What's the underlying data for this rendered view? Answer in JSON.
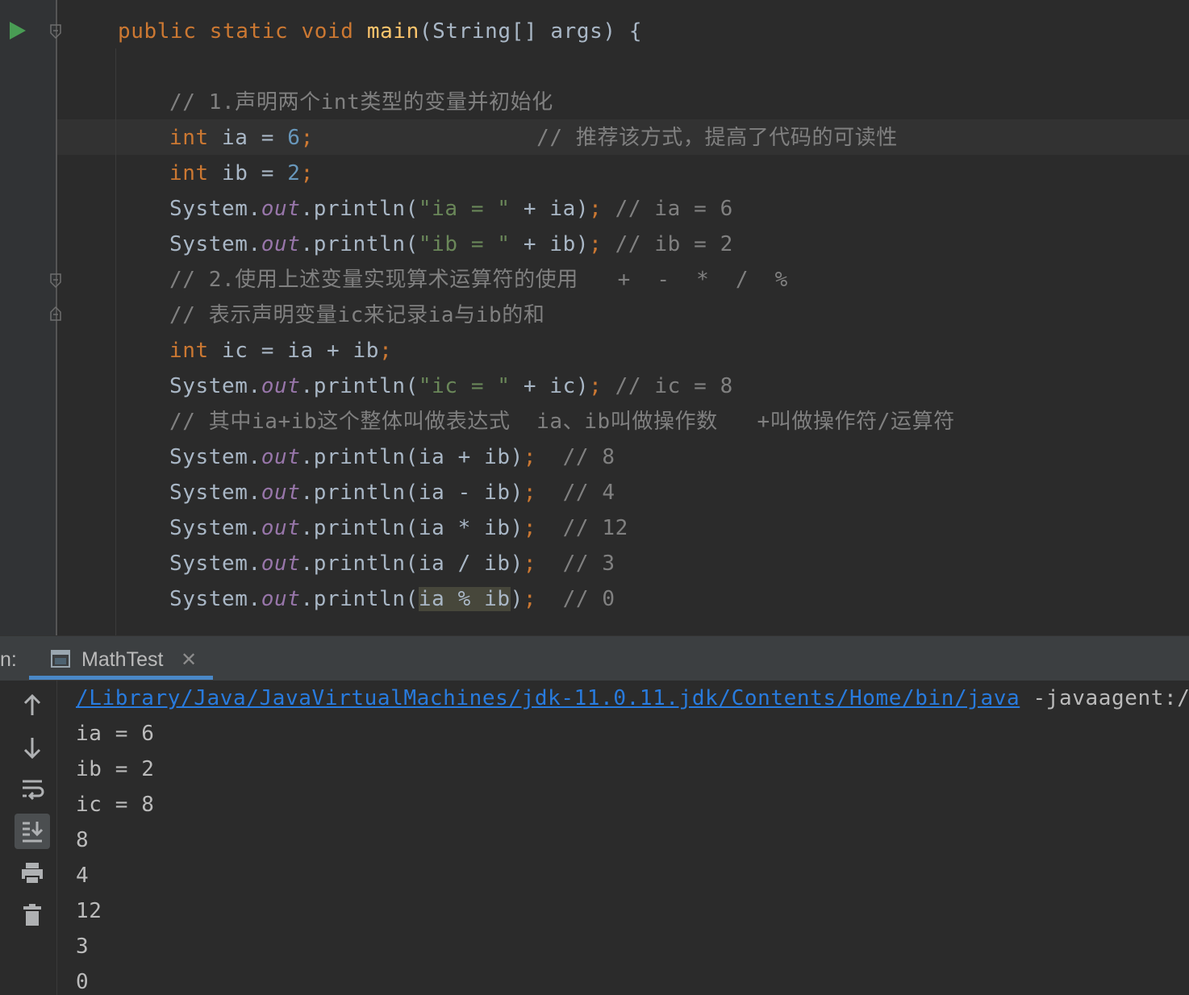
{
  "editor": {
    "lines": [
      [
        {
          "t": "public static void ",
          "c": "kw"
        },
        {
          "t": "main",
          "c": "fn"
        },
        {
          "t": "(String[] args) {",
          "c": ""
        }
      ],
      [],
      [
        {
          "t": "// 1.声明两个int类型的变量并初始化",
          "c": "cm"
        }
      ],
      [
        {
          "t": "int ",
          "c": "kw"
        },
        {
          "t": "ia = ",
          "c": ""
        },
        {
          "t": "6",
          "c": "num"
        },
        {
          "t": ";",
          "c": "kw"
        },
        {
          "t": "                 // 推荐该方式，提高了代码的可读性",
          "c": "cm"
        }
      ],
      [
        {
          "t": "int ",
          "c": "kw"
        },
        {
          "t": "ib = ",
          "c": ""
        },
        {
          "t": "2",
          "c": "num"
        },
        {
          "t": ";",
          "c": "kw"
        }
      ],
      [
        {
          "t": "System.",
          "c": ""
        },
        {
          "t": "out",
          "c": "fld"
        },
        {
          "t": ".println(",
          "c": ""
        },
        {
          "t": "\"ia = \"",
          "c": "str"
        },
        {
          "t": " + ia)",
          "c": ""
        },
        {
          "t": ";",
          "c": "kw"
        },
        {
          "t": " // ia = 6",
          "c": "cm"
        }
      ],
      [
        {
          "t": "System.",
          "c": ""
        },
        {
          "t": "out",
          "c": "fld"
        },
        {
          "t": ".println(",
          "c": ""
        },
        {
          "t": "\"ib = \"",
          "c": "str"
        },
        {
          "t": " + ib)",
          "c": ""
        },
        {
          "t": ";",
          "c": "kw"
        },
        {
          "t": " // ib = 2",
          "c": "cm"
        }
      ],
      [
        {
          "t": "// 2.使用上述变量实现算术运算符的使用   +  -  *  /  %",
          "c": "cm"
        }
      ],
      [
        {
          "t": "// 表示声明变量ic来记录ia与ib的和",
          "c": "cm"
        }
      ],
      [
        {
          "t": "int ",
          "c": "kw"
        },
        {
          "t": "ic = ia + ib",
          "c": ""
        },
        {
          "t": ";",
          "c": "kw"
        }
      ],
      [
        {
          "t": "System.",
          "c": ""
        },
        {
          "t": "out",
          "c": "fld"
        },
        {
          "t": ".println(",
          "c": ""
        },
        {
          "t": "\"ic = \"",
          "c": "str"
        },
        {
          "t": " + ic)",
          "c": ""
        },
        {
          "t": ";",
          "c": "kw"
        },
        {
          "t": " // ic = 8",
          "c": "cm"
        }
      ],
      [
        {
          "t": "// 其中ia+ib这个整体叫做表达式  ia、ib叫做操作数   +叫做操作符/运算符",
          "c": "cm"
        }
      ],
      [
        {
          "t": "System.",
          "c": ""
        },
        {
          "t": "out",
          "c": "fld"
        },
        {
          "t": ".println(ia + ib)",
          "c": ""
        },
        {
          "t": ";",
          "c": "kw"
        },
        {
          "t": "  // 8",
          "c": "cm"
        }
      ],
      [
        {
          "t": "System.",
          "c": ""
        },
        {
          "t": "out",
          "c": "fld"
        },
        {
          "t": ".println(ia - ib)",
          "c": ""
        },
        {
          "t": ";",
          "c": "kw"
        },
        {
          "t": "  // 4",
          "c": "cm"
        }
      ],
      [
        {
          "t": "System.",
          "c": ""
        },
        {
          "t": "out",
          "c": "fld"
        },
        {
          "t": ".println(ia * ib)",
          "c": ""
        },
        {
          "t": ";",
          "c": "kw"
        },
        {
          "t": "  // 12",
          "c": "cm"
        }
      ],
      [
        {
          "t": "System.",
          "c": ""
        },
        {
          "t": "out",
          "c": "fld"
        },
        {
          "t": ".println(ia / ib)",
          "c": ""
        },
        {
          "t": ";",
          "c": "kw"
        },
        {
          "t": "  // 3",
          "c": "cm"
        }
      ],
      [
        {
          "t": "System.",
          "c": ""
        },
        {
          "t": "out",
          "c": "fld"
        },
        {
          "t": ".println(",
          "c": ""
        },
        {
          "t": "ia % ib",
          "c": "hl"
        },
        {
          "t": ")",
          "c": ""
        },
        {
          "t": ";",
          "c": "kw"
        },
        {
          "t": "  // 0",
          "c": "cm"
        }
      ]
    ]
  },
  "run_panel": {
    "label": "n:",
    "tab": {
      "title": "MathTest",
      "close": "✕"
    },
    "console": {
      "java_path": "/Library/Java/JavaVirtualMachines/jdk-11.0.11.jdk/Contents/Home/bin/java",
      "java_args": " -javaagent:/Ap",
      "output": [
        "ia = 6",
        "ib = 2",
        "ic = 8",
        "8",
        "4",
        "12",
        "3",
        "0"
      ]
    },
    "toolbar": [
      "up-arrow-icon",
      "down-arrow-icon",
      "soft-wrap-icon",
      "scroll-to-end-icon",
      "print-icon",
      "trash-icon"
    ]
  },
  "colors": {
    "keyword": "#cc7832",
    "method": "#ffc66d",
    "number": "#6897bb",
    "string": "#6a8759",
    "comment": "#808080",
    "field": "#9876aa",
    "link": "#287bde",
    "run_icon": "#499c54"
  }
}
